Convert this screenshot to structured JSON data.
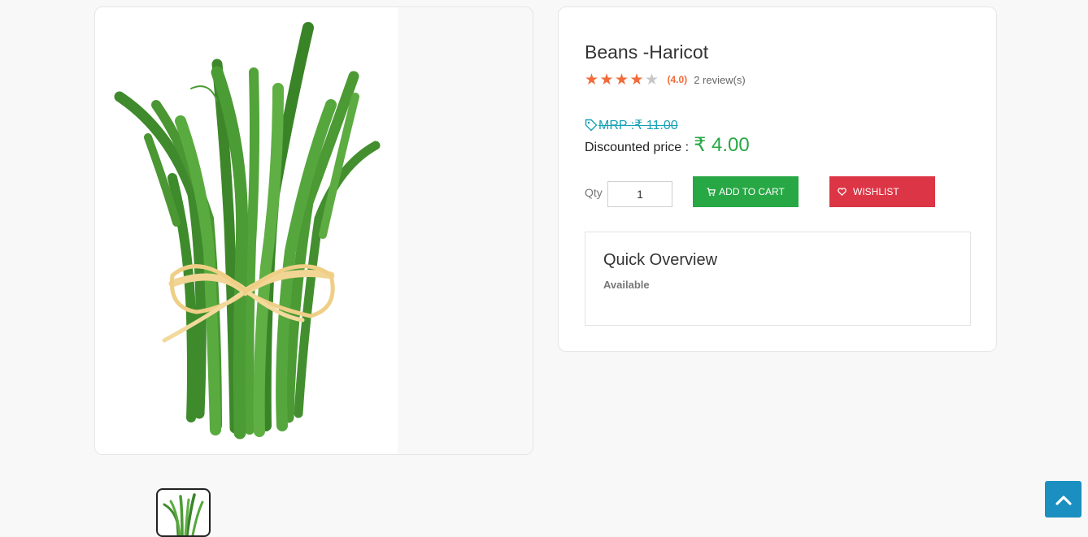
{
  "product": {
    "title": "Beans -Haricot",
    "rating_value": 4.0,
    "rating_max": 5,
    "rating_text": "(4.0)",
    "reviews_text": "2 review(s)",
    "mrp_text": "MRP :₹ 11.00",
    "discount_label": "Discounted price :",
    "discount_price": "₹ 4.00",
    "image_icon": "green-beans-bundle-image"
  },
  "purchase": {
    "qty_label": "Qty",
    "qty_value": "1",
    "add_to_cart_label": "ADD TO CART",
    "wishlist_label": "WISHLIST"
  },
  "overview": {
    "title": "Quick Overview",
    "status": "Available"
  },
  "colors": {
    "accent_green": "#28a745",
    "accent_red": "#dc3545",
    "star_orange": "#f26b3a",
    "mrp_teal": "#17a2b8",
    "scroll_blue": "#1a8fc0"
  }
}
